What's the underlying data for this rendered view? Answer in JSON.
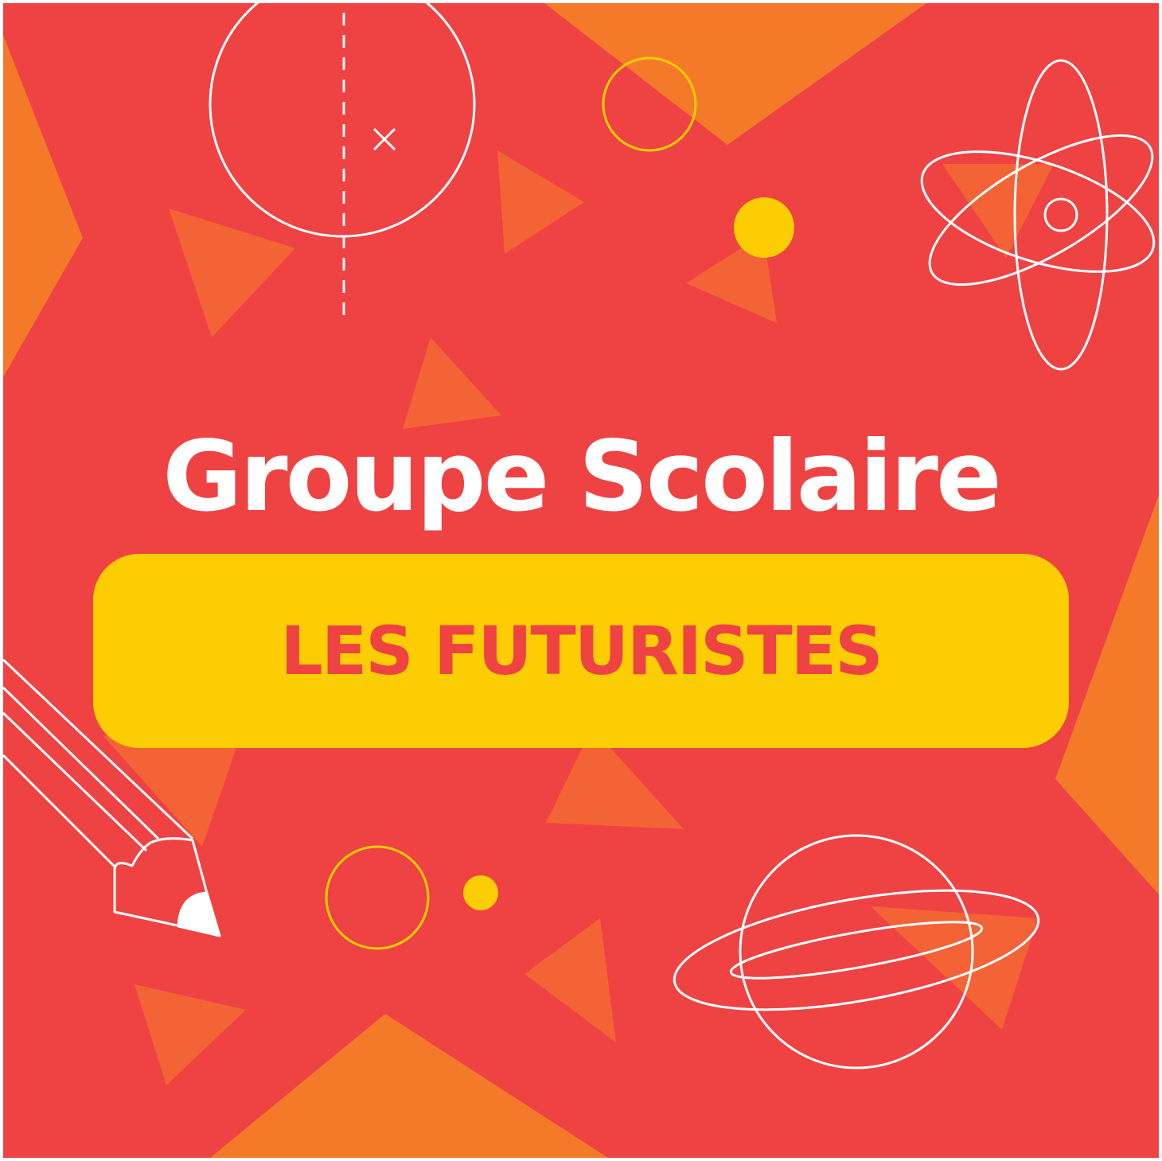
{
  "poster": {
    "title": "Groupe Scolaire",
    "subtitle": "LES FUTURISTES"
  },
  "colors": {
    "background": "#ef4243",
    "orange": "#f47a2a",
    "triangle": "#f46336",
    "yellow": "#fccd02",
    "text_light": "#ffffff",
    "subtitle_text": "#ef4243"
  },
  "icons": [
    "compass-circle-icon",
    "atom-icon",
    "pencil-icon",
    "planet-icon"
  ]
}
